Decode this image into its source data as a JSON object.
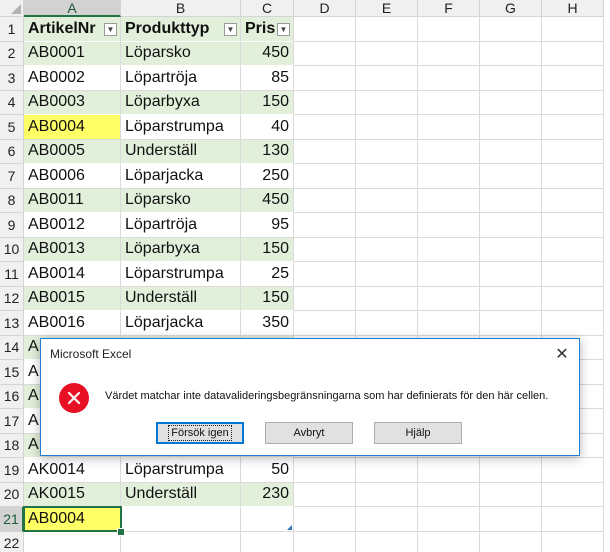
{
  "app": {
    "dialog_title": "Microsoft Excel"
  },
  "colors": {
    "band_green": "#e2efda",
    "highlight_yellow": "#ffff66",
    "selection_green": "#217346",
    "error_red": "#e81123"
  },
  "sheet": {
    "columns": [
      "A",
      "B",
      "C",
      "D",
      "E",
      "F",
      "G",
      "H"
    ],
    "rows": [
      {
        "n": "1",
        "a": "ArtikelNr",
        "b": "Produkttyp",
        "c": "Pris",
        "header": true
      },
      {
        "n": "2",
        "a": "AB0001",
        "b": "Löparsko",
        "c": "450",
        "band": true
      },
      {
        "n": "3",
        "a": "AB0002",
        "b": "Löpartröja",
        "c": "85",
        "band": false
      },
      {
        "n": "4",
        "a": "AB0003",
        "b": "Löparbyxa",
        "c": "150",
        "band": true
      },
      {
        "n": "5",
        "a": "AB0004",
        "b": "Löparstrumpa",
        "c": "40",
        "band": false,
        "a_yellow": true
      },
      {
        "n": "6",
        "a": "AB0005",
        "b": "Underställ",
        "c": "130",
        "band": true
      },
      {
        "n": "7",
        "a": "AB0006",
        "b": "Löparjacka",
        "c": "250",
        "band": false
      },
      {
        "n": "8",
        "a": "AB0011",
        "b": "Löparsko",
        "c": "450",
        "band": true
      },
      {
        "n": "9",
        "a": "AB0012",
        "b": "Löpartröja",
        "c": "95",
        "band": false
      },
      {
        "n": "10",
        "a": "AB0013",
        "b": "Löparbyxa",
        "c": "150",
        "band": true
      },
      {
        "n": "11",
        "a": "AB0014",
        "b": "Löparstrumpa",
        "c": "25",
        "band": false
      },
      {
        "n": "12",
        "a": "AB0015",
        "b": "Underställ",
        "c": "150",
        "band": true
      },
      {
        "n": "13",
        "a": "AB0016",
        "b": "Löparjacka",
        "c": "350",
        "band": false
      },
      {
        "n": "14",
        "a": "A",
        "b": "",
        "c": "",
        "band": true
      },
      {
        "n": "15",
        "a": "A",
        "b": "",
        "c": "",
        "band": false
      },
      {
        "n": "16",
        "a": "A",
        "b": "",
        "c": "",
        "band": true
      },
      {
        "n": "17",
        "a": "A",
        "b": "",
        "c": "",
        "band": false
      },
      {
        "n": "18",
        "a": "A",
        "b": "",
        "c": "",
        "band": true
      },
      {
        "n": "19",
        "a": "AK0014",
        "b": "Löparstrumpa",
        "c": "50",
        "band": false
      },
      {
        "n": "20",
        "a": "AK0015",
        "b": "Underställ",
        "c": "230",
        "band": true
      },
      {
        "n": "21",
        "a": "AB0004",
        "b": "",
        "c": "",
        "band": false,
        "a_yellow": true,
        "selected": true
      },
      {
        "n": "22",
        "a": "",
        "b": "",
        "c": "",
        "band": false,
        "empty": true
      }
    ]
  },
  "dialog": {
    "message": "Värdet matchar inte datavalideringsbegränsningarna som har definierats för den här cellen.",
    "buttons": {
      "retry": "Försök igen",
      "cancel": "Avbryt",
      "help": "Hjälp"
    },
    "close_icon": "close-icon",
    "error_icon": "error-icon"
  }
}
